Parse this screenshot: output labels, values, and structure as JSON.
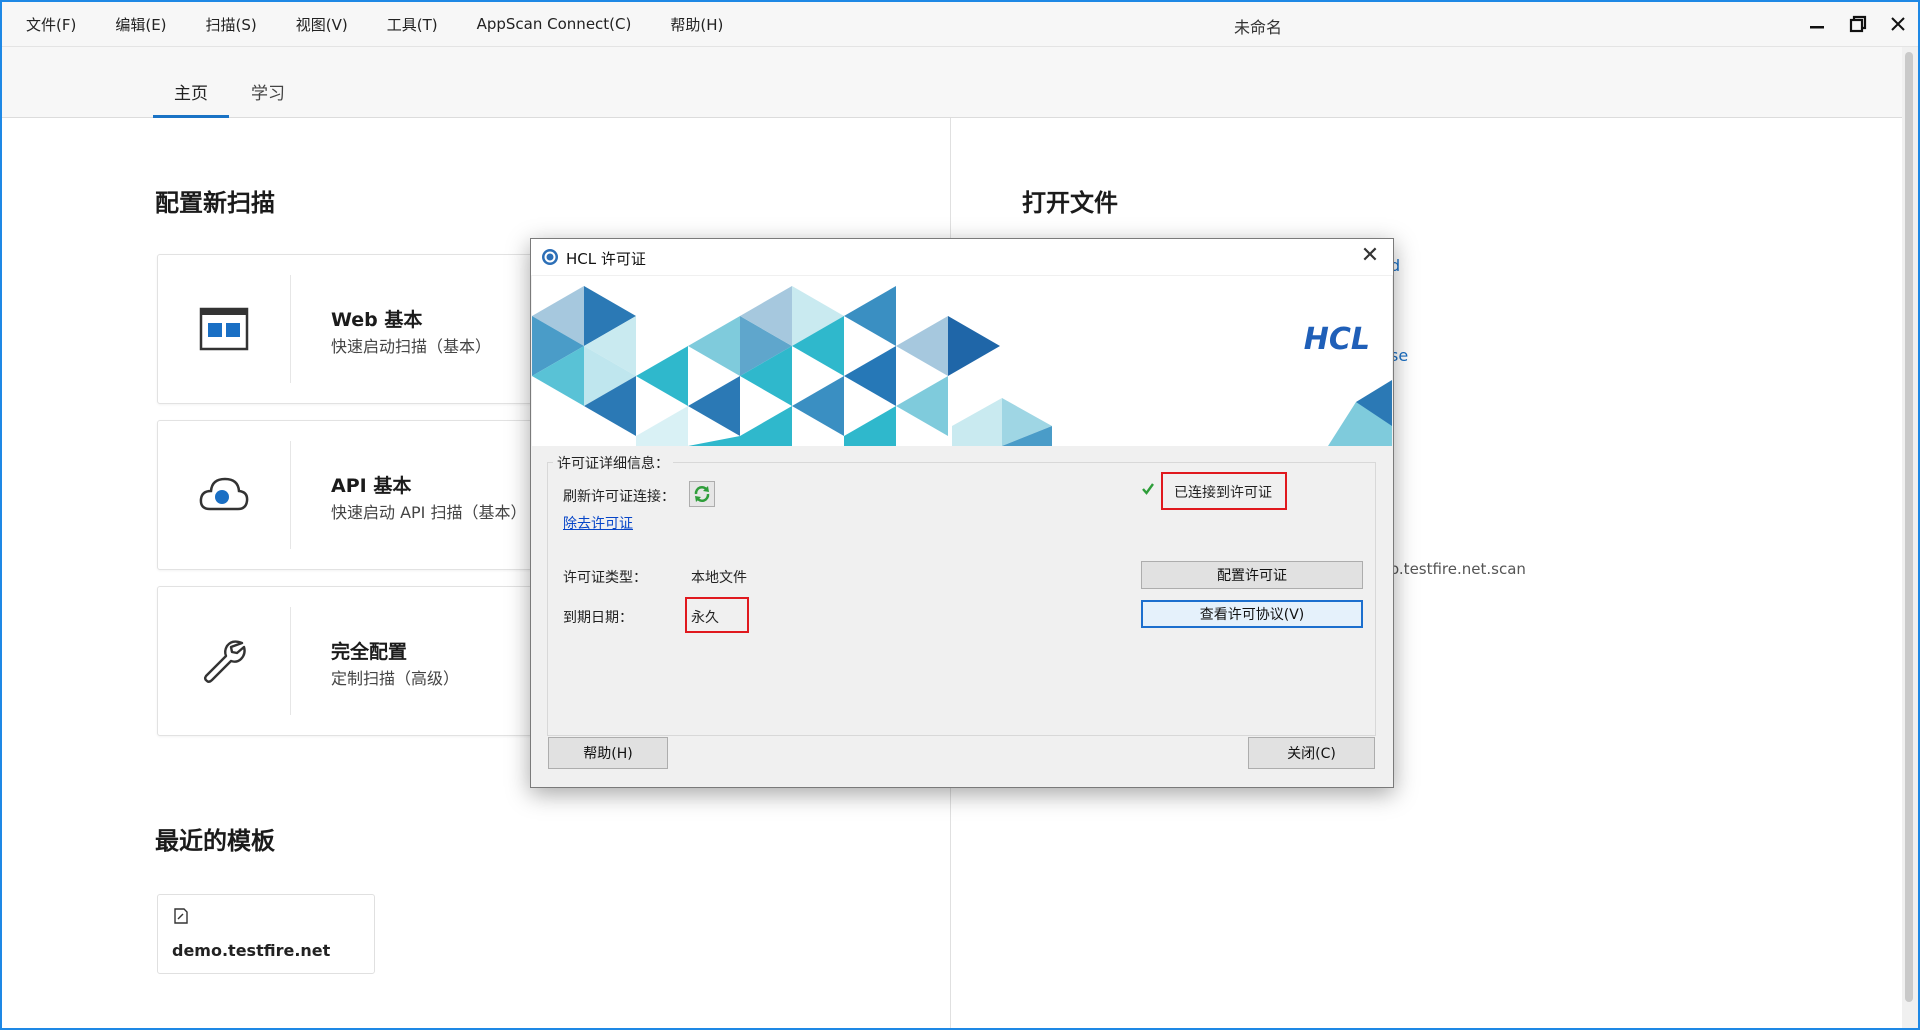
{
  "menu": [
    "文件(F)",
    "编辑(E)",
    "扫描(S)",
    "视图(V)",
    "工具(T)",
    "AppScan Connect(C)",
    "帮助(H)"
  ],
  "window": {
    "title": "未命名",
    "minimize_icon": "minimize-icon",
    "restore_icon": "restore-icon",
    "close_icon": "close-icon"
  },
  "tabs": [
    {
      "label": "主页",
      "active": true
    },
    {
      "label": "学习",
      "active": false
    }
  ],
  "left": {
    "configure_heading": "配置新扫描",
    "cards": [
      {
        "title": "Web 基本",
        "subtitle": "快速启动扫描（基本）",
        "icon": "web-window-icon"
      },
      {
        "title": "API 基本",
        "subtitle": "快速启动 API 扫描（基本）",
        "icon": "cloud-api-icon"
      },
      {
        "title": "完全配置",
        "subtitle": "定制扫描（高级）",
        "icon": "wrench-icon"
      }
    ],
    "recent_heading": "最近的模板",
    "templates": [
      {
        "name": "demo.testfire.net",
        "icon": "template-icon"
      }
    ]
  },
  "right": {
    "open_heading": "打开文件",
    "peek_texts": [
      "d",
      "se",
      "o.testfire.net.scan"
    ]
  },
  "dialog": {
    "title": "HCL 许可证",
    "brand": "HCL",
    "group_label": "许可证详细信息：",
    "refresh_label": "刷新许可证连接：",
    "remove_link": "除去许可证",
    "status": "已连接到许可证",
    "license_type_label": "许可证类型：",
    "license_type_value": "本地文件",
    "expiry_label": "到期日期：",
    "expiry_value": "永久",
    "configure_button": "配置许可证",
    "view_agreement_button": "查看许可协议(V)",
    "help_button": "帮助(H)",
    "close_button": "关闭(C)",
    "colors": {
      "brand": "#1f5fb8",
      "highlight": "#e0191e",
      "ok": "#2e9e3a"
    }
  }
}
